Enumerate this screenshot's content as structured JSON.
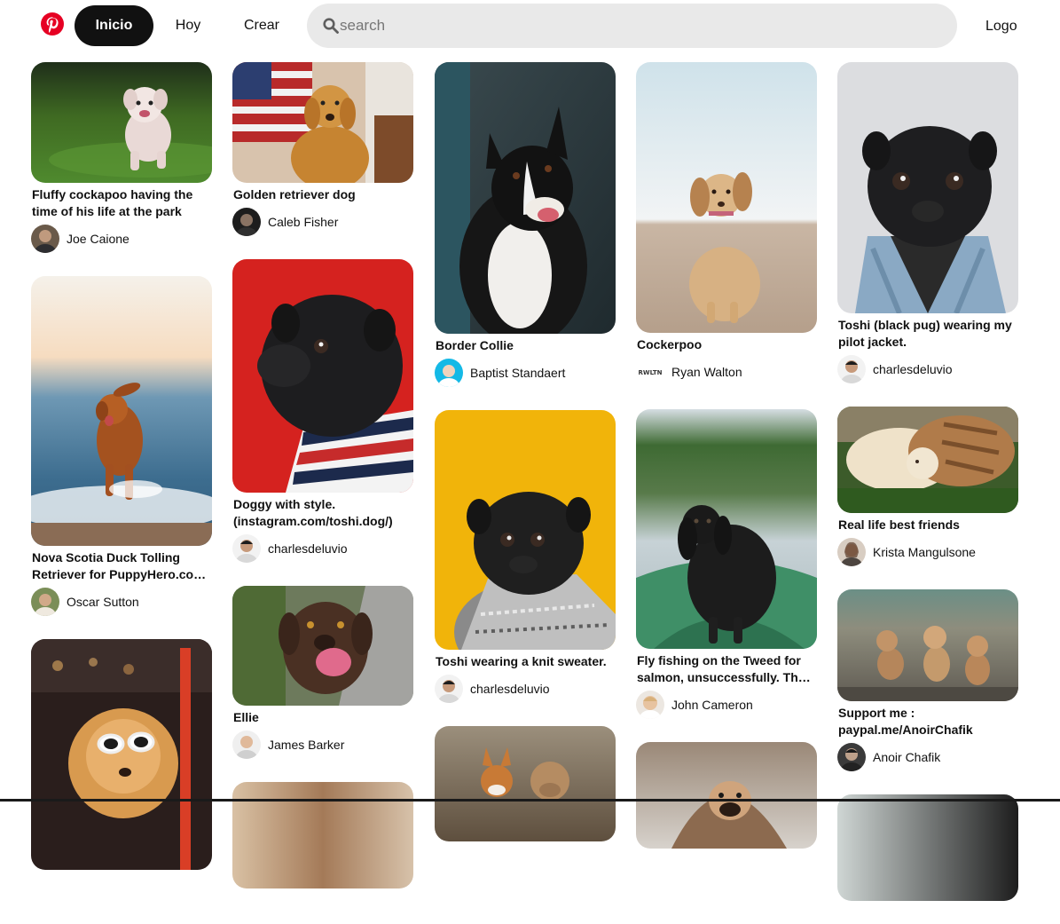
{
  "nav": {
    "home": "Inicio",
    "today": "Hoy",
    "create": "Crear",
    "search_placeholder": "search",
    "profile": "Logo"
  },
  "columns": [
    [
      {
        "title": "Fluffy cockapoo having the time of his life at the park",
        "author": "Joe Caione"
      },
      {
        "title": "Nova Scotia Duck Tolling Retriever for PuppyHero.com: https://www.puppyhero.com/",
        "author": "Oscar Sutton"
      },
      {
        "title": "",
        "author": ""
      }
    ],
    [
      {
        "title": "Golden retriever dog",
        "author": "Caleb Fisher"
      },
      {
        "title": "Doggy with style. (instagram.com/toshi.dog/)",
        "author": "charlesdeluvio"
      },
      {
        "title": "Ellie",
        "author": "James Barker"
      },
      {
        "title": "",
        "author": ""
      }
    ],
    [
      {
        "title": "Border Collie",
        "author": "Baptist Standaert"
      },
      {
        "title": "Toshi wearing a knit sweater.",
        "author": "charlesdeluvio"
      },
      {
        "title": "",
        "author": ""
      }
    ],
    [
      {
        "title": "Cockerpoo",
        "author": "Ryan Walton"
      },
      {
        "title": "Fly fishing on the Tweed for salmon, unsuccessfully. The dog was happy though.",
        "author": "John Cameron"
      },
      {
        "title": "",
        "author": ""
      }
    ],
    [
      {
        "title": "Toshi (black pug) wearing my pilot jacket.",
        "author": "charlesdeluvio"
      },
      {
        "title": "Real life best friends",
        "author": "Krista Mangulsone"
      },
      {
        "title": "Support me : paypal.me/AnoirChafik",
        "author": "Anoir Chafik"
      },
      {
        "title": "",
        "author": ""
      }
    ]
  ],
  "avatar_badge": "RWLTN",
  "colors": {
    "brand_red": "#e60023",
    "nav_active_bg": "#111111",
    "search_bg": "#e9e9e9"
  }
}
